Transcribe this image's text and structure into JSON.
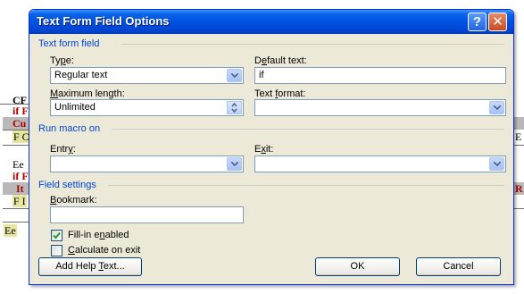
{
  "background_doc": {
    "fragments": [
      {
        "text": "CF",
        "cls": "bold"
      },
      {
        "text": "if F",
        "cls": "red"
      },
      {
        "text": "Cu",
        "cls": "red"
      },
      {
        "text": "F C",
        "cls": ""
      },
      {
        "text": "Ee",
        "cls": ""
      },
      {
        "text": "if F",
        "cls": "red"
      },
      {
        "text": "It",
        "cls": "red"
      },
      {
        "text": "F I",
        "cls": ""
      },
      {
        "text": "Ee",
        "cls": ""
      },
      {
        "text": "E",
        "cls": ""
      },
      {
        "text": "R",
        "cls": "red"
      }
    ]
  },
  "dialog": {
    "title": "Text Form Field Options",
    "help_glyph": "?",
    "close_glyph": "✕",
    "text_form_field": {
      "group_title": "Text form field",
      "type_label_pre": "Ty",
      "type_label_u": "p",
      "type_label_post": "e:",
      "type_value": "Regular text",
      "default_label_pre": "D",
      "default_label_u": "e",
      "default_label_post": "fault text:",
      "default_value": "if",
      "maxlen_label_pre": "",
      "maxlen_label_u": "M",
      "maxlen_label_post": "aximum length:",
      "maxlen_value": "Unlimited",
      "format_label_pre": "Text ",
      "format_label_u": "f",
      "format_label_post": "ormat:",
      "format_value": ""
    },
    "run_macro": {
      "group_title": "Run macro on",
      "entry_label_pre": "Entr",
      "entry_label_u": "y",
      "entry_label_post": ":",
      "entry_value": "",
      "exit_label_pre": "E",
      "exit_label_u": "x",
      "exit_label_post": "it:",
      "exit_value": ""
    },
    "field_settings": {
      "group_title": "Field settings",
      "bookmark_label_pre": "",
      "bookmark_label_u": "B",
      "bookmark_label_post": "ookmark:",
      "bookmark_value": "",
      "fillin_label_pre": "Fill-in e",
      "fillin_label_u": "n",
      "fillin_label_post": "abled",
      "fillin_checked": true,
      "calc_label_pre": "",
      "calc_label_u": "C",
      "calc_label_post": "alculate on exit",
      "calc_checked": false
    },
    "buttons": {
      "add_help_pre": "Add Help ",
      "add_help_u": "T",
      "add_help_post": "ext...",
      "ok": "OK",
      "cancel": "Cancel"
    }
  }
}
